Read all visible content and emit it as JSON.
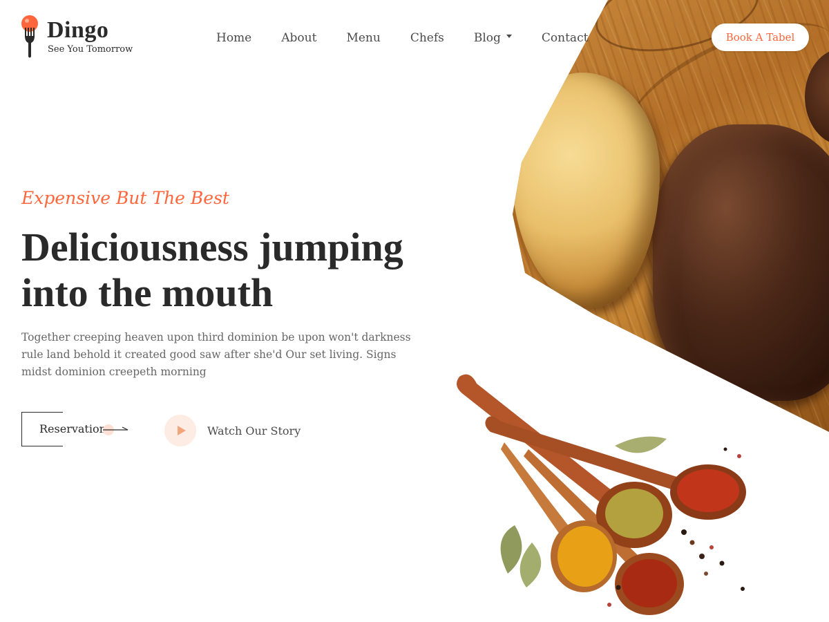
{
  "brand": {
    "name": "Dingo",
    "tagline": "See You Tomorrow",
    "accent_color": "#ff663b"
  },
  "nav": {
    "items": [
      {
        "label": "Home"
      },
      {
        "label": "About"
      },
      {
        "label": "Menu"
      },
      {
        "label": "Chefs"
      },
      {
        "label": "Blog",
        "has_dropdown": true
      },
      {
        "label": "Contact"
      }
    ]
  },
  "header": {
    "cta_label": "Book A Tabel"
  },
  "hero": {
    "tagline": "Expensive But The Best",
    "headline": "Deliciousness jumping into the mouth",
    "description": "Together creeping heaven upon third dominion be upon won't darkness rule land behold it created good saw after she'd Our set living. Signs midst dominion creepeth morning",
    "reservation_label": "Reservation",
    "watch_label": "Watch Our Story"
  },
  "icons": {
    "logo": "fork-with-orange-icon",
    "reservation": "arrow-right-icon",
    "watch": "play-icon",
    "blog_dropdown": "caret-down-icon"
  },
  "images": {
    "hero": "grilled steak with baked potato on wooden board",
    "spices": "wooden spoons with ground spices and peppercorns"
  }
}
